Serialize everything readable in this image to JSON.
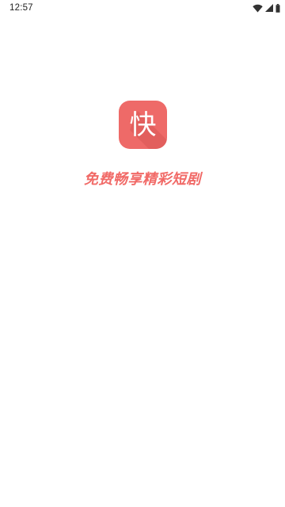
{
  "status_bar": {
    "time": "12:57",
    "icons": [
      "wifi-icon",
      "signal-icon",
      "battery-icon"
    ]
  },
  "splash": {
    "app_icon_glyph": "快",
    "tagline": "免费畅享精彩短剧"
  },
  "colors": {
    "brand": "#ee6a68",
    "tagline": "#f16a67",
    "background": "#ffffff"
  }
}
